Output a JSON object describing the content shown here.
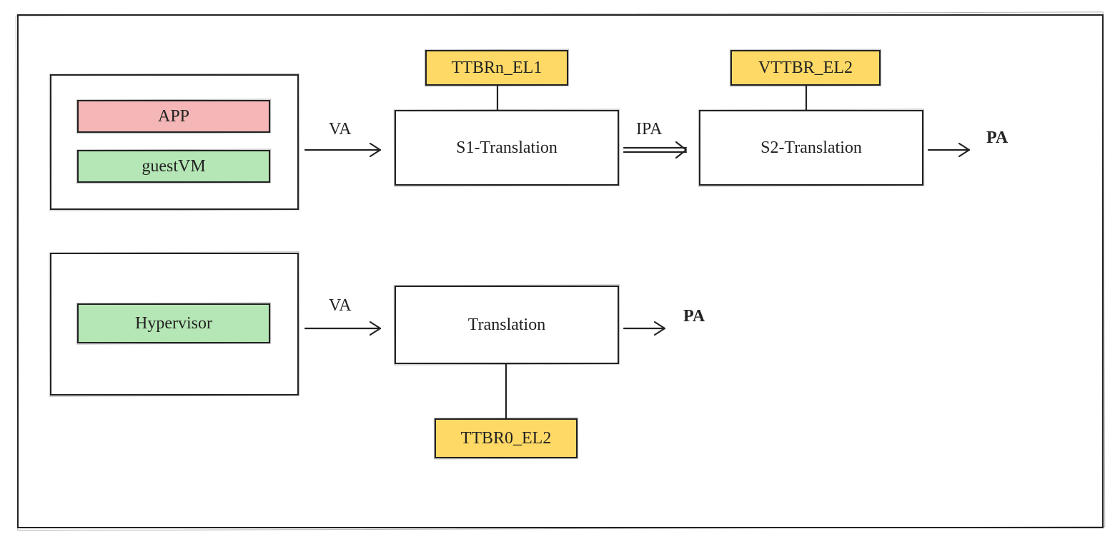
{
  "outer": {},
  "row1": {
    "group_box": {},
    "app": {
      "label": "APP"
    },
    "guestvm": {
      "label": "guestVM"
    },
    "va_label": "VA",
    "s1": {
      "label": "S1-Translation"
    },
    "ttbr_el1": {
      "label": "TTBRn_EL1"
    },
    "ipa_label": "IPA",
    "s2": {
      "label": "S2-Translation"
    },
    "vttbr_el2": {
      "label": "VTTBR_EL2"
    },
    "pa_label": "PA"
  },
  "row2": {
    "group_box": {},
    "hypervisor": {
      "label": "Hypervisor"
    },
    "va_label": "VA",
    "trans": {
      "label": "Translation"
    },
    "ttbr0_el2": {
      "label": "TTBR0_EL2"
    },
    "pa_label": "PA"
  }
}
